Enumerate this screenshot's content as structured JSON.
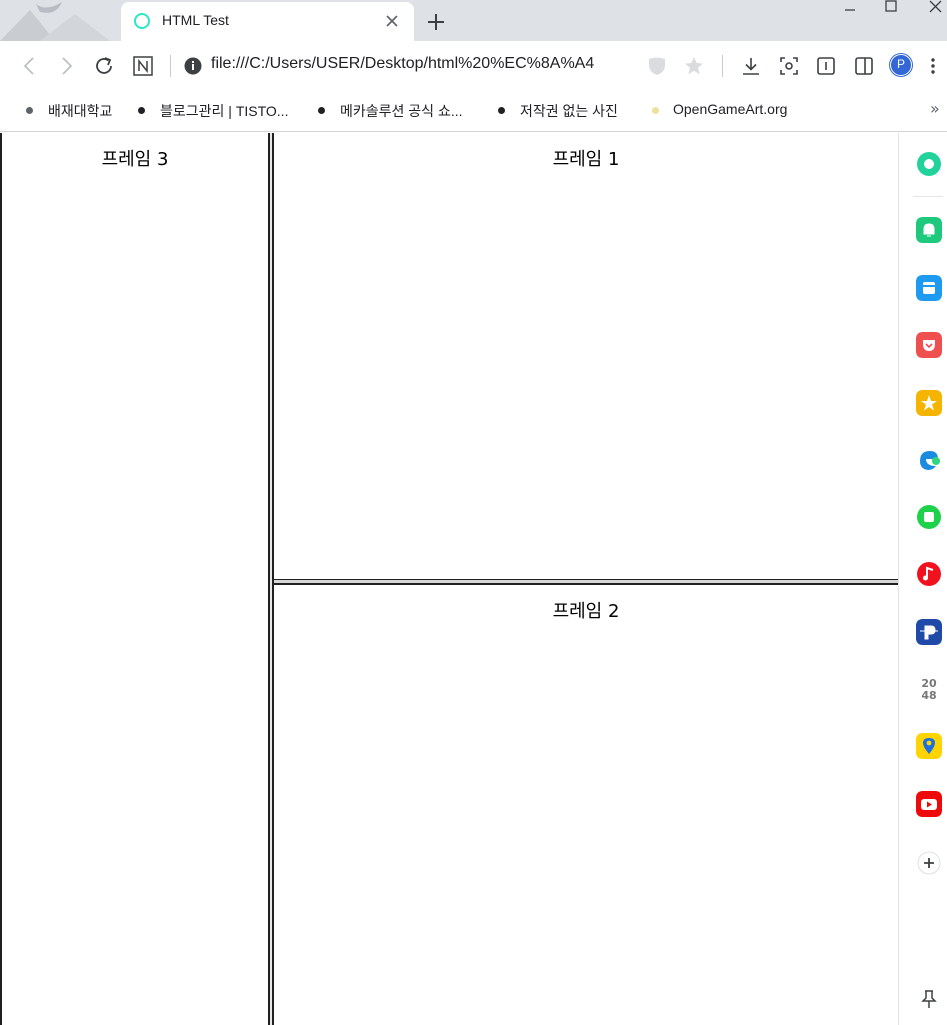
{
  "tab": {
    "title": "HTML Test",
    "favicon": "circle-favicon-icon"
  },
  "toolbar": {
    "url": "file:///C:/Users/USER/Desktop/html%20%EC%8A%A4",
    "profile_initial": "P"
  },
  "bookmarks": [
    {
      "label": "배재대학교"
    },
    {
      "label": "블로그관리 | TISTO..."
    },
    {
      "label": "메카솔루션 공식 쇼..."
    },
    {
      "label": "저작권 없는 사진"
    },
    {
      "label": "OpenGameArt.org"
    }
  ],
  "frames": {
    "frame3": "프레임 3",
    "frame1": "프레임 1",
    "frame2": "프레임 2"
  },
  "side_panel": [
    "edge-copilot-icon",
    "notification-icon",
    "calendar-icon",
    "pocket-icon",
    "favorites-star-icon",
    "edge-drop-icon",
    "naver-square-icon",
    "music-icon",
    "pay-icon",
    "2048-game-icon",
    "map-pin-icon",
    "youtube-icon",
    "add-icon",
    "pin-icon"
  ],
  "colors": {
    "accent_teal": "#2ee6c8",
    "profile_blue": "#3367d6"
  }
}
